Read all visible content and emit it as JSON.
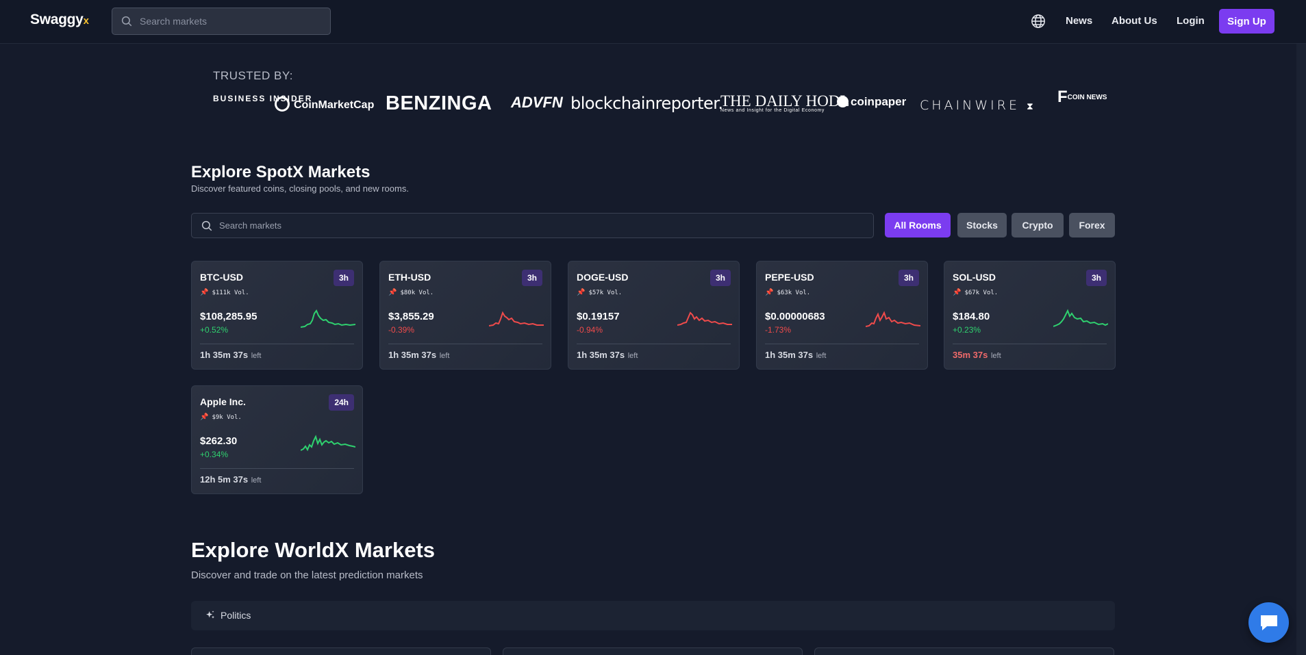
{
  "nav": {
    "brand": "Swaggy",
    "brand_suffix": "x",
    "search_placeholder": "Search markets",
    "links": {
      "news": "News",
      "about": "About Us",
      "login": "Login"
    },
    "signup": "Sign Up"
  },
  "trusted": {
    "label": "TRUSTED BY:",
    "logos": {
      "business_insider": "BUSINESS INSIDER",
      "coinmarketcap": "CoinMarketCap",
      "benzinga": "BENZINGA",
      "advfn": "ADVFN",
      "blockchainreporter": "blockchainreporter.",
      "daily_hodl": "THE DAILY HODL",
      "daily_hodl_tagline": "News and Insight for the Digital Economy",
      "coinpaper": "coinpaper",
      "chainwire": "CHAINWIRE",
      "coin_news": "COIN NEWS"
    }
  },
  "spotx": {
    "title": "Explore SpotX Markets",
    "subtitle": "Discover featured coins, closing pools, and new rooms.",
    "search_placeholder": "Search markets",
    "filters": [
      "All Rooms",
      "Stocks",
      "Crypto",
      "Forex"
    ],
    "active_filter": "All Rooms",
    "left_label": "left",
    "cards": [
      {
        "name": "BTC-USD",
        "badge": "3h",
        "vol": "$111k Vol.",
        "price": "$108,285.95",
        "change": "+0.52%",
        "direction": "up",
        "timer": "1h 35m 37s",
        "urgent": false
      },
      {
        "name": "ETH-USD",
        "badge": "3h",
        "vol": "$80k Vol.",
        "price": "$3,855.29",
        "change": "-0.39%",
        "direction": "down",
        "timer": "1h 35m 37s",
        "urgent": false
      },
      {
        "name": "DOGE-USD",
        "badge": "3h",
        "vol": "$57k Vol.",
        "price": "$0.19157",
        "change": "-0.94%",
        "direction": "down",
        "timer": "1h 35m 37s",
        "urgent": false
      },
      {
        "name": "PEPE-USD",
        "badge": "3h",
        "vol": "$63k Vol.",
        "price": "$0.00000683",
        "change": "-1.73%",
        "direction": "down",
        "timer": "1h 35m 37s",
        "urgent": false
      },
      {
        "name": "SOL-USD",
        "badge": "3h",
        "vol": "$67k Vol.",
        "price": "$184.80",
        "change": "+0.23%",
        "direction": "up",
        "timer": "35m 37s",
        "urgent": true
      },
      {
        "name": "Apple Inc.",
        "badge": "24h",
        "vol": "$9k Vol.",
        "price": "$262.30",
        "change": "+0.34%",
        "direction": "up",
        "timer": "12h 5m 37s",
        "urgent": false
      }
    ]
  },
  "worldx": {
    "title": "Explore WorldX Markets",
    "subtitle": "Discover and trade on the latest prediction markets",
    "category": "Politics"
  },
  "colors": {
    "accent": "#7b3cf0",
    "up": "#2fd16f",
    "down": "#f04b4b",
    "background": "#151b2b",
    "chat": "#2f7be8"
  },
  "icons": {
    "search": "search-icon",
    "globe": "globe-icon",
    "pin": "pin-icon",
    "sparkle": "sparkle-icon",
    "chat": "chat-icon"
  }
}
